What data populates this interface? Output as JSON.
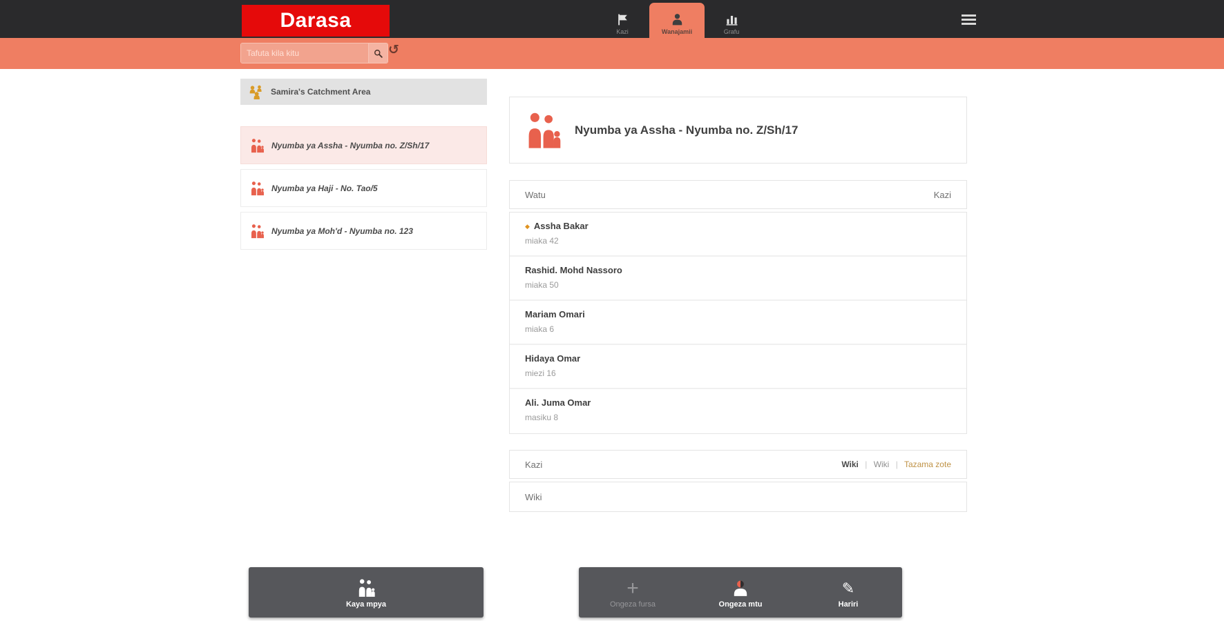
{
  "colors": {
    "brand_red": "#e50a0a",
    "coral": "#ef7e62",
    "icon_coral": "#e8614d",
    "amber": "#d99b27",
    "topbar_dark": "#2a2a2c",
    "action_bar_gray": "#56575b",
    "selected_pink": "#fbe9e7"
  },
  "topbar": {
    "logo": "Darasa",
    "tabs": [
      {
        "label": "Kazi",
        "icon": "flag-icon",
        "active": false
      },
      {
        "label": "Wanajamii",
        "icon": "person-icon",
        "active": true
      },
      {
        "label": "Grafu",
        "icon": "bar-chart-icon",
        "active": false
      }
    ]
  },
  "searchbar": {
    "placeholder": "Tafuta kila kitu"
  },
  "sidebar": {
    "catchment_label": "Samira's Catchment Area",
    "households": [
      {
        "label": "Nyumba ya Assha - Nyumba no. Z/Sh/17",
        "selected": true
      },
      {
        "label": "Nyumba ya Haji - No. Tao/5",
        "selected": false
      },
      {
        "label": "Nyumba ya Moh'd - Nyumba no. 123",
        "selected": false
      }
    ],
    "new_household_label": "Kaya mpya"
  },
  "main": {
    "title": "Nyumba ya Assha - Nyumba no. Z/Sh/17",
    "people_header": {
      "left": "Watu",
      "right": "Kazi"
    },
    "people": [
      {
        "name": "Assha Bakar",
        "detail": "miaka 42",
        "flagged": true
      },
      {
        "name": "Rashid. Mohd Nassoro",
        "detail": "miaka 50",
        "flagged": false
      },
      {
        "name": "Mariam Omari",
        "detail": "miaka 6",
        "flagged": false
      },
      {
        "name": "Hidaya Omar",
        "detail": "miezi 16",
        "flagged": false
      },
      {
        "name": "Ali. Juma Omar",
        "detail": "masiku 8",
        "flagged": false
      }
    ],
    "tasks_header": {
      "left": "Kazi",
      "filter_bold": "Wiki",
      "filter_dim": "Wiki",
      "separator": "|",
      "view_all": "Tazama zote"
    },
    "task_group_label": "Wiki",
    "actions": [
      {
        "label": "Ongeza fursa",
        "disabled": true
      },
      {
        "label": "Ongeza mtu",
        "disabled": false
      },
      {
        "label": "Hariri",
        "disabled": false
      }
    ]
  }
}
